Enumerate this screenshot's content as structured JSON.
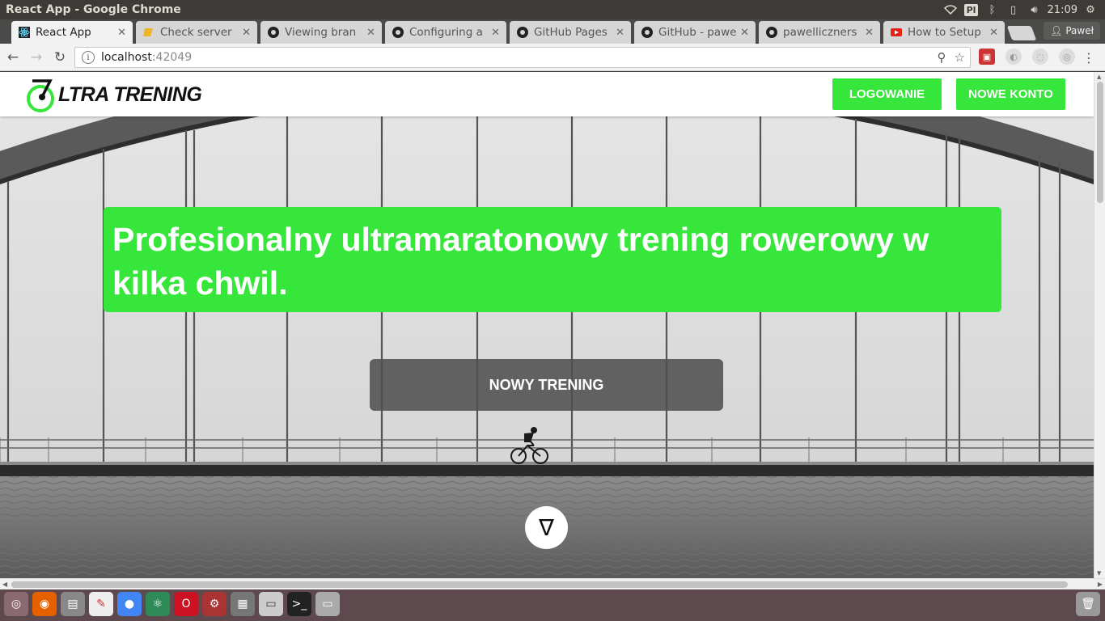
{
  "os": {
    "window_title": "React App - Google Chrome",
    "keyboard_layout": "Pl",
    "clock": "21:09",
    "user": "Paweł"
  },
  "tabs": [
    {
      "title": "React App",
      "icon": "react-icon",
      "active": true
    },
    {
      "title": "Check server",
      "icon": "cpanel-icon"
    },
    {
      "title": "Viewing bran",
      "icon": "github-icon"
    },
    {
      "title": "Configuring a",
      "icon": "github-icon"
    },
    {
      "title": "GitHub Pages",
      "icon": "github-icon"
    },
    {
      "title": "GitHub - pawe",
      "icon": "github-icon"
    },
    {
      "title": "pawelliczners",
      "icon": "github-icon"
    },
    {
      "title": "How to Setup",
      "icon": "youtube-icon"
    }
  ],
  "toolbar": {
    "url_host": "localhost",
    "url_port": ":42049"
  },
  "app": {
    "logo_text": "LTRA TRENING",
    "login_label": "LOGOWANIE",
    "register_label": "NOWE KONTO",
    "headline": "Profesionalny ultramaratonowy trening rowerowy w kilka chwil.",
    "cta_label": "NOWY TRENING",
    "scroll_glyph": "∇",
    "accent_color": "#36e63b"
  }
}
